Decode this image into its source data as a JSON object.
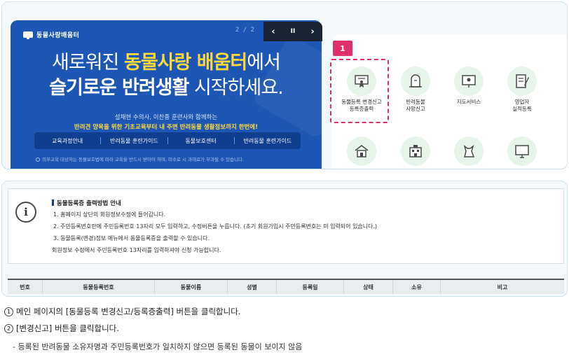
{
  "banner": {
    "logo_text": "동물사랑배움터",
    "pager": "2 / 2",
    "controls": {
      "prev": "‹",
      "pause": "II",
      "next": "›"
    },
    "headline1_pre": "새로워진 ",
    "headline1_emph": "동물사랑 배움터",
    "headline1_post": "에서",
    "headline2_emph": "슬기로운 반려생활",
    "headline2_post": " 시작하세요.",
    "sub1": "설채현 수의사, 이찬종 훈련사와 함께하는",
    "sub2": "반려견 양육을 위한 기초교육부터 내 주변 반려동물 생활정보까지 한번에!",
    "menu": [
      "교육과정안내",
      "반려동물 훈련가이드",
      "동물보호센터",
      "반려동물 훈련가이드"
    ],
    "note": "의무교육 대상자는 동물보호법에 따라 교육을 반드시 받아야 하며, 미수료 시 과태료가 부과될 수 있습니다."
  },
  "highlight_badge": "1",
  "services": [
    {
      "label": "동물등록 변경신고\n등록증출력",
      "icon": "certificate-icon"
    },
    {
      "label": "반려동물\n사망신고",
      "icon": "gravestone-icon"
    },
    {
      "label": "지도서비스",
      "icon": "map-board-icon"
    },
    {
      "label": "영업자\n실적등록",
      "icon": "document-pen-icon"
    },
    {
      "label": "",
      "icon": "house-icon"
    },
    {
      "label": "",
      "icon": "building-icon"
    },
    {
      "label": "",
      "icon": "cat-icon"
    },
    {
      "label": "",
      "icon": "monitor-icon"
    }
  ],
  "guide": {
    "title": "동물등록증 출력방법 안내",
    "lines": [
      "1. 홈페이지 상단의 회원정보수정에 들어갑니다.",
      "2. 주민등록번호란에 주민등록번호 13자리 모두 입력하고, 수정버튼을 누릅니다. (초기 회원가입시 주민등록번호는 미 입력되어 있습니다.)",
      "3. 동물등록(변경)정보 메뉴에서 동물등록증을 출력할 수 있습니다.",
      "회원정보 수정에서 주민등록번호 13자리를 입력하셔야 신청 가능합니다."
    ]
  },
  "table": {
    "headers": [
      "번호",
      "동물등록번호",
      "동물이름",
      "성별",
      "등록일",
      "상태",
      "소유",
      "비고"
    ]
  },
  "instructions": {
    "step1_num": "1",
    "step1": "메인 페이지의 [동물등록 변경신고/등록증출력] 버튼을 클릭합니다.",
    "step2_num": "2",
    "step2": "[변경신고] 버튼을 클릭합니다.",
    "note": "- 등록된 반려동물 소유자명과 주민등록번호가 일치하지 않으면 등록된 동물이 보이지 않음"
  },
  "colors": {
    "banner_blue": "#1d56b5",
    "accent_pink": "#e0306b",
    "headline_yellow": "#ffd83a",
    "icon_bg": "#e6f4ea"
  }
}
